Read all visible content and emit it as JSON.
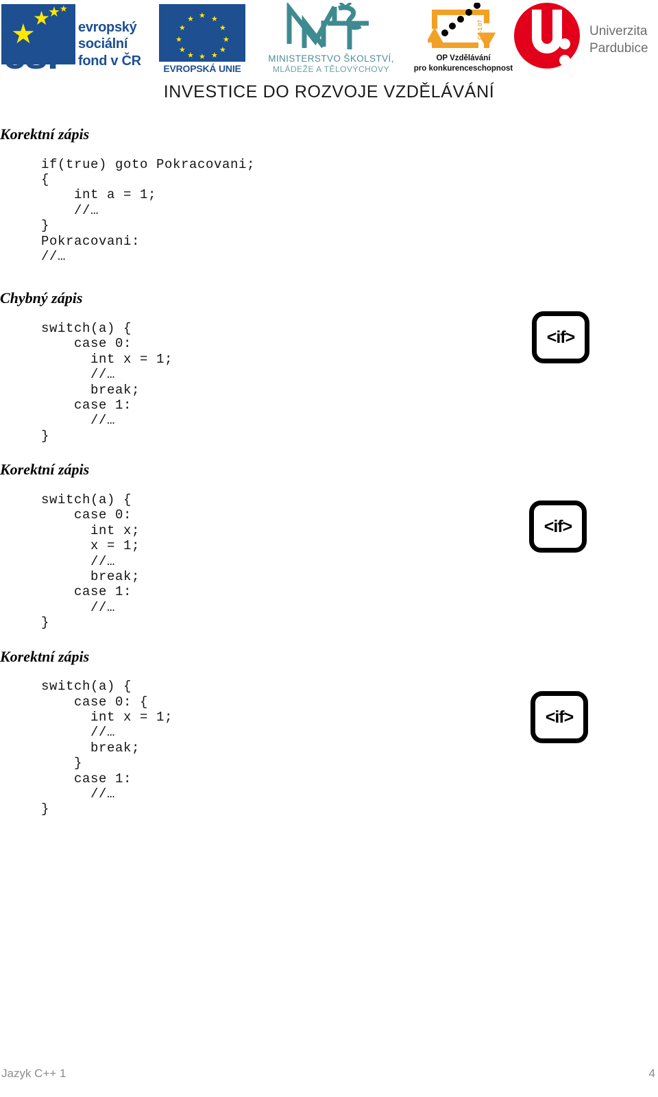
{
  "header": {
    "logos": [
      {
        "name": "esf",
        "line1": "evropský",
        "line2": "sociální",
        "line3": "fond v ČR",
        "letters": "esf",
        "flag_color": "#1d4f91",
        "star_color": "#ffe800"
      },
      {
        "name": "european-union",
        "caption": "EVROPSKÁ UNIE",
        "flag_color": "#1d4f91",
        "star_color": "#ffe800"
      },
      {
        "name": "msmt",
        "mark": "MŠMT",
        "line1": "MINISTERSTVO ŠKOLSTVÍ,",
        "line2": "MLÁDEŽE A TĚLOVÝCHOVY",
        "color": "#4c8f96"
      },
      {
        "name": "op-vzdelavani",
        "line1": "OP Vzdělávání",
        "line2": "pro konkurenceschopnost",
        "mark_label": "CZ-1.07",
        "color": "#f2a127"
      },
      {
        "name": "univerzita-pardubice",
        "line1": "Univerzita",
        "line2": "Pardubice",
        "color": "#e2001a"
      }
    ],
    "banner": "INVESTICE DO ROZVOJE VZDĚLÁVÁNÍ"
  },
  "sections": [
    {
      "heading": "Korektní zápis",
      "code": "if(true) goto Pokracovani;\n{\n    int a = 1;\n    //…\n}\nPokracovani:\n//…",
      "icon": null
    },
    {
      "heading": "Chybný zápis",
      "code": "switch(a) {\n    case 0:\n      int x = 1;\n      //…\n      break;\n    case 1:\n      //…\n}",
      "icon": "if-tag-icon"
    },
    {
      "heading": "Korektní zápis",
      "code": "switch(a) {\n    case 0:\n      int x;\n      x = 1;\n      //…\n      break;\n    case 1:\n      //…\n}",
      "icon": "if-tag-icon"
    },
    {
      "heading": "Korektní zápis",
      "code": "switch(a) {\n    case 0: {\n      int x = 1;\n      //…\n      break;\n    }\n    case 1:\n      //…\n}",
      "icon": "if-tag-icon"
    }
  ],
  "icons": {
    "if_label": "<if>"
  },
  "footer": {
    "left": "Jazyk C++ 1",
    "right": "4"
  }
}
